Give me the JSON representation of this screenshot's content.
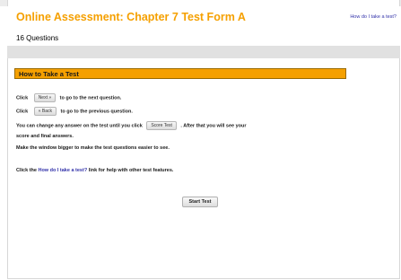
{
  "header": {
    "title": "Online Assessment: Chapter 7 Test Form A",
    "help_link": "How do I take a test?",
    "question_count": "16 Questions"
  },
  "section": {
    "title": "How to Take a Test"
  },
  "instructions": {
    "next_pre": "Click",
    "next_button": "Next »",
    "next_post": "to go to the next question.",
    "back_pre": "Click",
    "back_button": "« Back",
    "back_post": "to go to the previous question.",
    "score_pre": "You can change any answer on the test until you click",
    "score_button": "Score Test",
    "score_post": ". After that you will see your",
    "score_line2": "score and final answers.",
    "window_line": "Make the window bigger to make the test questions easier to see.",
    "help_pre": "Click the",
    "help_link": "How do I take a test?",
    "help_post": "link for help with other test features."
  },
  "start_button": "Start Test",
  "colors": {
    "accent": "#f5a000",
    "link": "#3333aa",
    "band": "#e1e1e1"
  }
}
